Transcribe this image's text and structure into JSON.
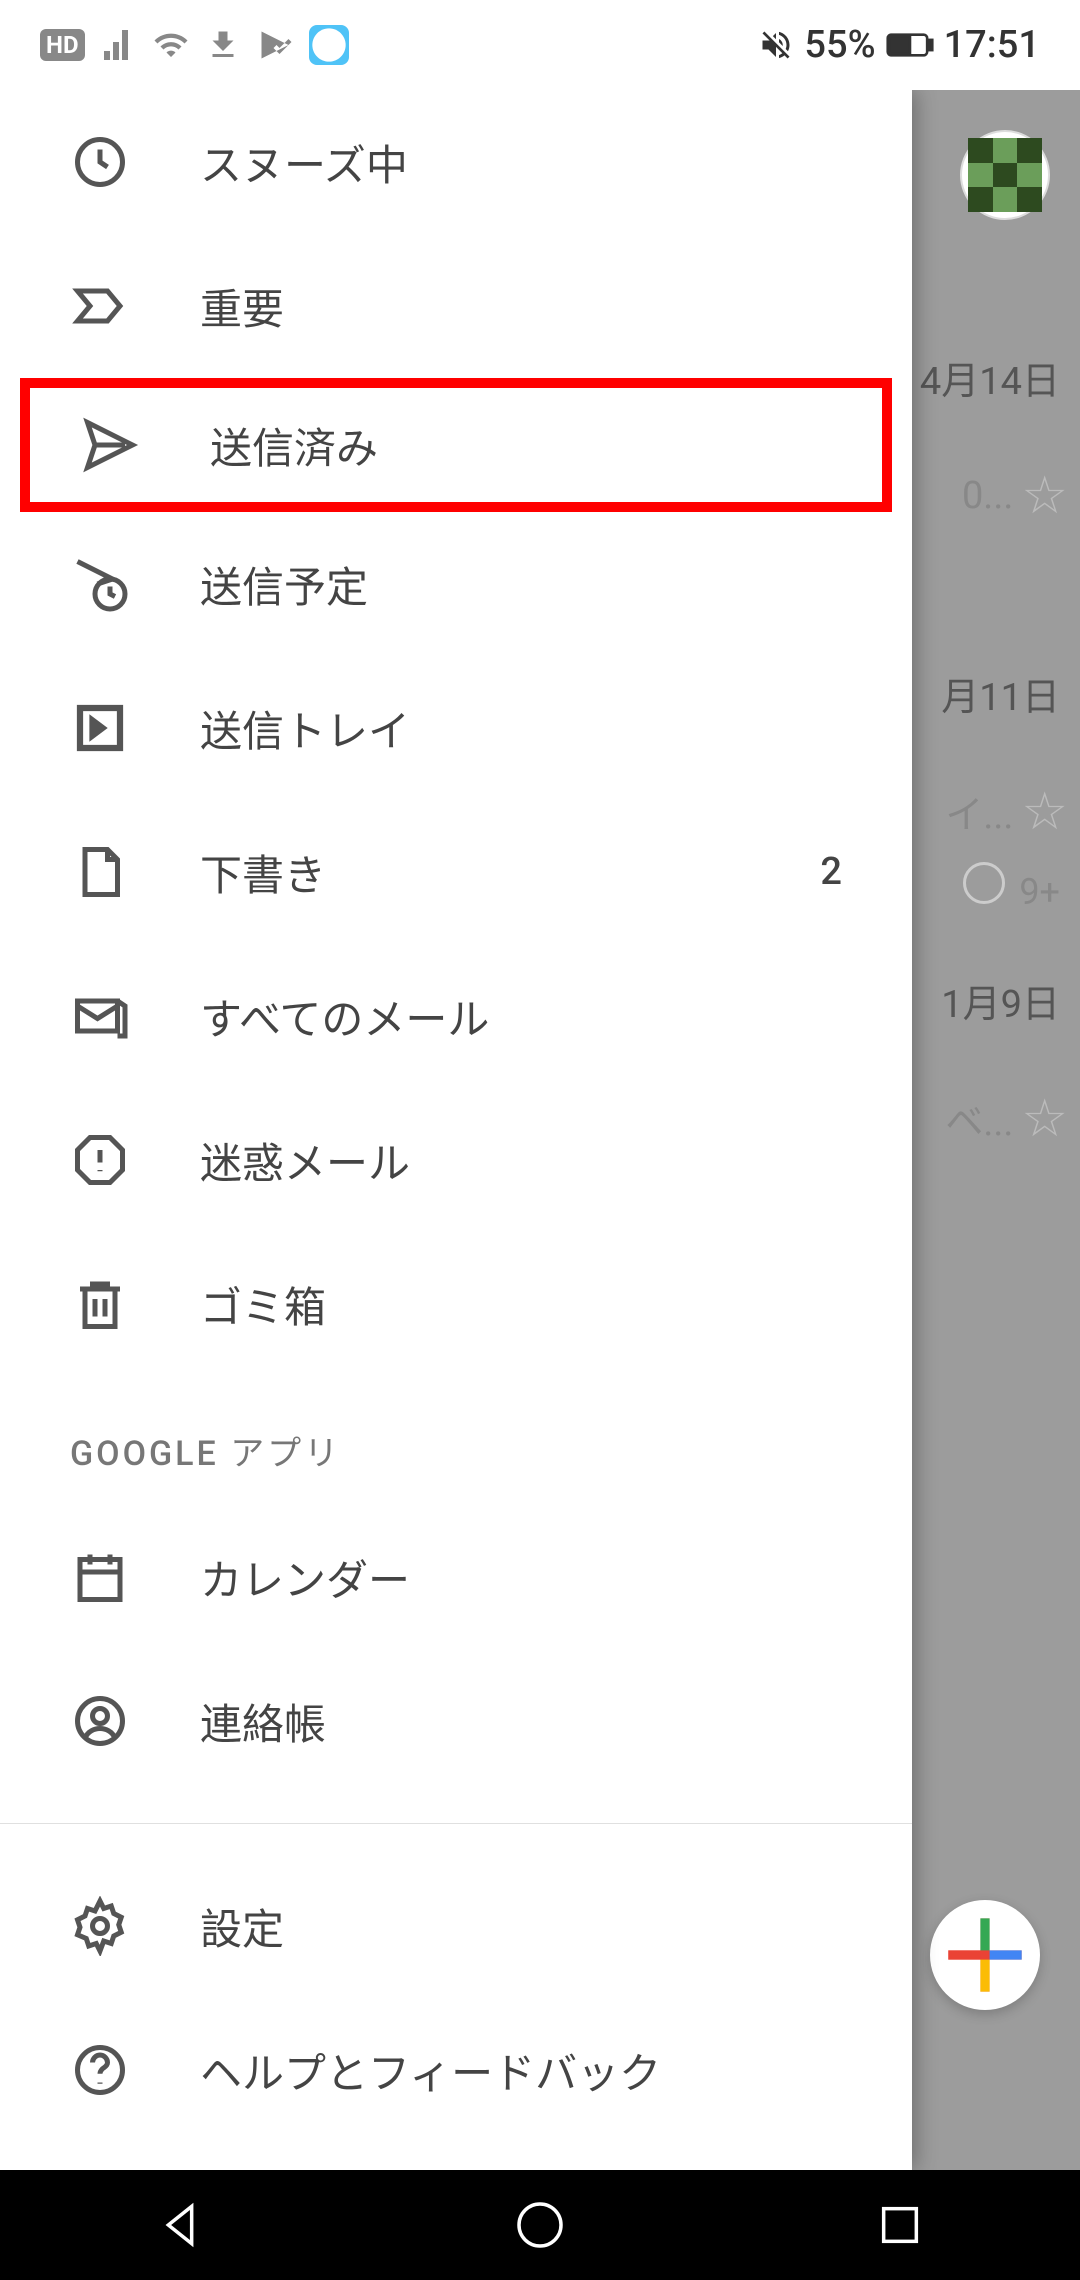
{
  "status_bar": {
    "hd": "HD",
    "battery_text": "55%",
    "time": "17:51"
  },
  "drawer": {
    "items": [
      {
        "label": "スヌーズ中",
        "icon": "clock"
      },
      {
        "label": "重要",
        "icon": "label"
      },
      {
        "label": "送信済み",
        "icon": "send",
        "highlighted": true
      },
      {
        "label": "送信予定",
        "icon": "schedule-send"
      },
      {
        "label": "送信トレイ",
        "icon": "outbox"
      },
      {
        "label": "下書き",
        "icon": "draft",
        "count": "2"
      },
      {
        "label": "すべてのメール",
        "icon": "all-mail"
      },
      {
        "label": "迷惑メール",
        "icon": "spam"
      },
      {
        "label": "ゴミ箱",
        "icon": "trash"
      }
    ],
    "section_google": "GOOGLE アプリ",
    "google_items": [
      {
        "label": "カレンダー",
        "icon": "calendar"
      },
      {
        "label": "連絡帳",
        "icon": "contacts"
      }
    ],
    "footer_items": [
      {
        "label": "設定",
        "icon": "settings"
      },
      {
        "label": "ヘルプとフィードバック",
        "icon": "help"
      }
    ]
  },
  "emails": {
    "row1_date": "4月14日",
    "row1_snippet": "0...",
    "row2_date": "月11日",
    "row2_snippet": "イ...",
    "badge": "9+",
    "row3_date": "1月9日",
    "row3_snippet": "ベ..."
  }
}
